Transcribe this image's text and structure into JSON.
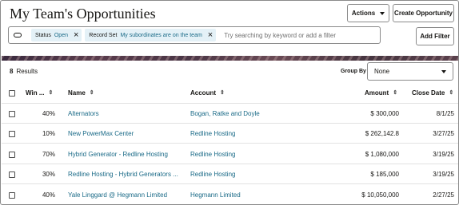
{
  "page": {
    "title": "My Team's Opportunities"
  },
  "toolbar": {
    "actions_label": "Actions",
    "create_label": "Create Opportunity",
    "add_filter_label": "Add Filter"
  },
  "search": {
    "chips": [
      {
        "key": "Status",
        "value": "Open"
      },
      {
        "key": "Record Set",
        "value": "My subordinates are on the team"
      }
    ],
    "placeholder": "Try searching by keyword or add a filter"
  },
  "results": {
    "count": "8",
    "label": "Results"
  },
  "group_by": {
    "label": "Group By",
    "value": "None"
  },
  "table": {
    "columns": [
      "Win ...",
      "Name",
      "Account",
      "Amount",
      "Close Date"
    ],
    "rows": [
      {
        "win": "40%",
        "name": "Alternators",
        "account": "Bogan, Ratke and Doyle",
        "amount": "$ 300,000",
        "close": "8/1/25"
      },
      {
        "win": "10%",
        "name": "New PowerMax Center",
        "account": "Redline Hosting",
        "amount": "$ 262,142.8",
        "close": "3/27/25"
      },
      {
        "win": "70%",
        "name": "Hybrid Generator - Redline Hosting",
        "account": "Redline Hosting",
        "amount": "$ 1,080,000",
        "close": "3/19/25"
      },
      {
        "win": "30%",
        "name": "Redline Hosting - Hybrid Generators ...",
        "account": "Redline Hosting",
        "amount": "$ 185,000",
        "close": "3/19/25"
      },
      {
        "win": "40%",
        "name": "Yale Linggard @ Hegmann Limited",
        "account": "Hegmann Limited",
        "amount": "$ 10,050,000",
        "close": "2/27/25"
      }
    ]
  },
  "icons": {
    "sort": "sort-updown-icon",
    "close": "close-icon",
    "caret": "caret-down-icon",
    "filter_toggle": "filter-toggle-icon"
  },
  "colors": {
    "link": "#1a6a87",
    "chip_bg": "#e4f1f7"
  }
}
